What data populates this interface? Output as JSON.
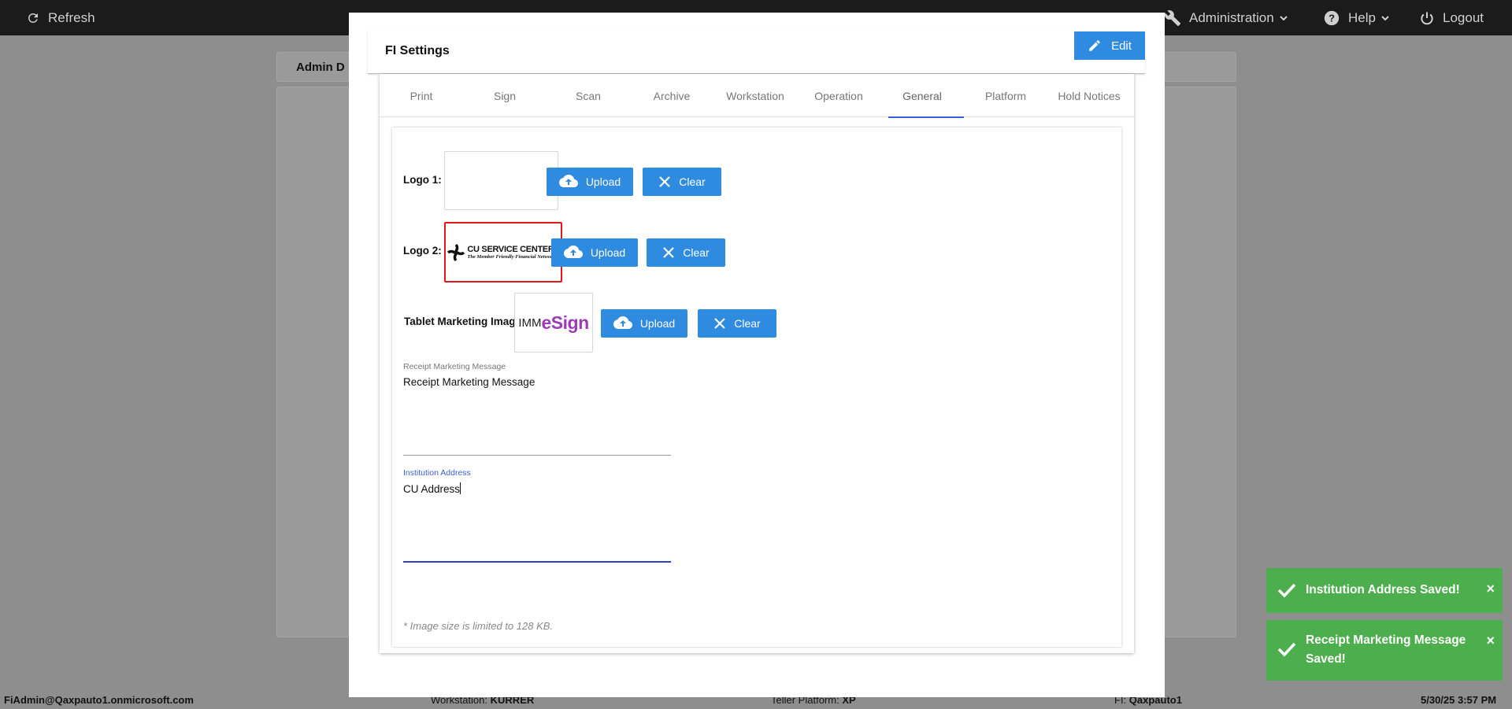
{
  "topbar": {
    "refresh_label": "Refresh",
    "administration_label": "Administration",
    "help_label": "Help",
    "logout_label": "Logout"
  },
  "background": {
    "tab_label": "Admin D"
  },
  "modal": {
    "title": "FI Settings",
    "edit_label": "Edit",
    "tabs": [
      "Print",
      "Sign",
      "Scan",
      "Archive",
      "Workstation",
      "Operation",
      "General",
      "Platform",
      "Hold Notices"
    ],
    "active_tab": "General",
    "logo1": {
      "label": "Logo 1:",
      "upload_label": "Upload",
      "clear_label": "Clear"
    },
    "logo2": {
      "label": "Logo 2:",
      "upload_label": "Upload",
      "clear_label": "Clear",
      "logo_text": "CU SERVICE CENTERS",
      "logo_tagline": "The Member Friendly Financial Network"
    },
    "tablet": {
      "label": "Tablet Marketing Image:",
      "upload_label": "Upload",
      "clear_label": "Clear",
      "logo_prefix": "IMM",
      "logo_suffix": "eSign"
    },
    "receipt_message": {
      "label": "Receipt Marketing Message",
      "value": "Receipt Marketing Message"
    },
    "institution_address": {
      "label": "Institution Address",
      "value": "CU Address"
    },
    "note": "* Image size is limited to 128 KB."
  },
  "statusbar": {
    "user": "FiAdmin@Qaxpauto1.onmicrosoft.com",
    "workstation_label": "Workstation:",
    "workstation_value": "KURRER",
    "teller_platform_label": "Teller Platform:",
    "teller_platform_value": "XP",
    "fi_label": "FI:",
    "fi_value": "Qaxpauto1",
    "datetime": "5/30/25 3:57 PM"
  },
  "toasts": [
    {
      "message": "Institution Address Saved!",
      "close": "×"
    },
    {
      "message": "Receipt Marketing Message Saved!",
      "close": "×"
    }
  ],
  "colors": {
    "primary_button": "#2f8be0",
    "success_toast": "#4cae4c",
    "active_tab_indicator": "#3b5fcf",
    "selected_logo_border": "#e01818"
  }
}
